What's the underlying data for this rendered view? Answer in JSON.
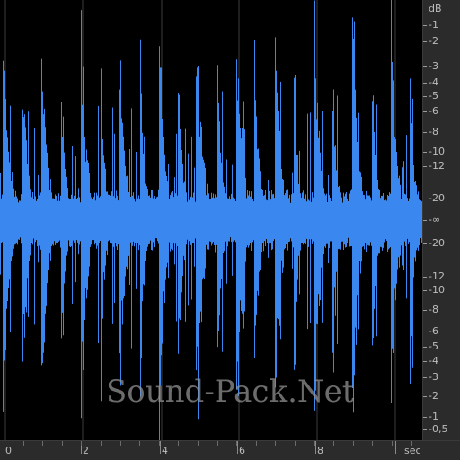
{
  "colors": {
    "waveform": "#3a87f0",
    "background": "#000000",
    "ruler_bg": "#2b2b2b",
    "ruler_text": "#bdbdbd",
    "grid": "#3c3c3c"
  },
  "db_ruler": {
    "unit": "dB",
    "labels": [
      "-1",
      "-2",
      "-3",
      "-4",
      "-5",
      "-6",
      "-8",
      "-10",
      "-12",
      "-20",
      "-∞",
      "-20",
      "-12",
      "-10",
      "-8",
      "-6",
      "-5",
      "-4",
      "-3",
      "-2",
      "-1",
      "-0,5"
    ]
  },
  "time_ruler": {
    "labels": [
      "0",
      "2",
      "4",
      "6",
      "8"
    ],
    "unit": "sec"
  },
  "watermark": "Sound-Pack.Net"
}
